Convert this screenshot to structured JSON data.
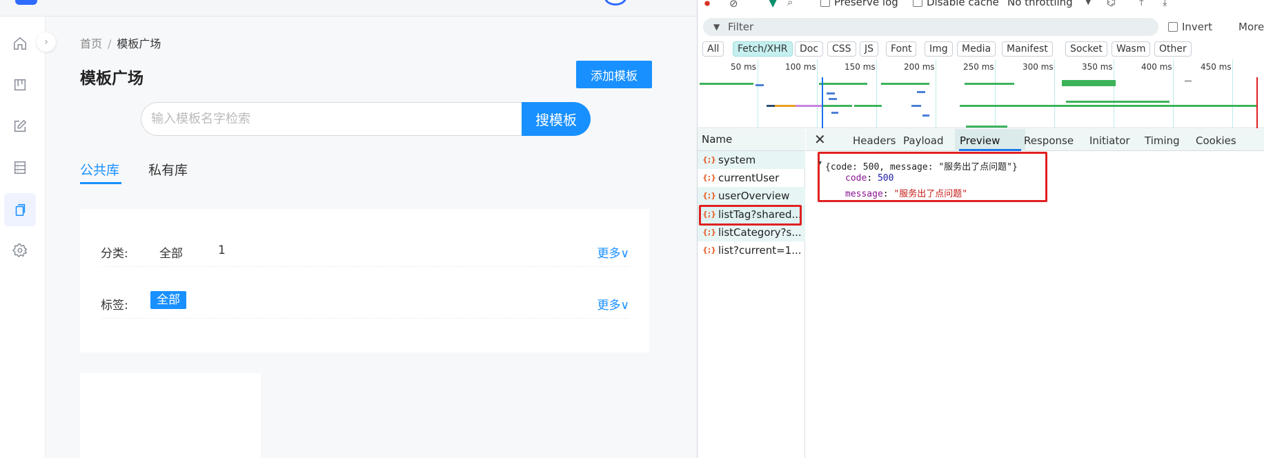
{
  "app": {
    "name": "...",
    "breadcrumb": {
      "home": "首页",
      "separator": "/",
      "current": "模板广场"
    },
    "title": "模板广场",
    "add_button": "添加模板",
    "search": {
      "placeholder": "输入模板名字检索",
      "button": "搜模板"
    },
    "tabs": [
      {
        "label": "公共库",
        "active": true
      },
      {
        "label": "私有库",
        "active": false
      }
    ],
    "filters": {
      "category": {
        "label": "分类:",
        "options": [
          "全部",
          "1"
        ],
        "more": "更多"
      },
      "tag": {
        "label": "标签:",
        "options": [
          "全部"
        ],
        "more": "更多"
      }
    },
    "sidebar_icons": [
      "home-icon",
      "board-icon",
      "edit-icon",
      "storage-icon",
      "copy-icon",
      "gear-icon"
    ],
    "accent_color": "#1890ff"
  },
  "devtools": {
    "toolbar": {
      "preserve_log": "Preserve log",
      "disable_cache": "Disable cache",
      "throttling": "No throttling"
    },
    "filter": {
      "placeholder": "Filter",
      "invert": "Invert",
      "more": "More"
    },
    "types": [
      "All",
      "Fetch/XHR",
      "Doc",
      "CSS",
      "JS",
      "Font",
      "Img",
      "Media",
      "Manifest",
      "Socket",
      "Wasm",
      "Other"
    ],
    "active_type": "Fetch/XHR",
    "timeline_ticks": [
      "50 ms",
      "100 ms",
      "150 ms",
      "200 ms",
      "250 ms",
      "300 ms",
      "350 ms",
      "400 ms",
      "450 ms"
    ],
    "name_header": "Name",
    "requests": [
      "system",
      "currentUser",
      "userOverview",
      "listTag?shared...",
      "listCategory?s...",
      "list?current=1..."
    ],
    "selected_request": "listTag?shared...",
    "detail_tabs": [
      "Headers",
      "Payload",
      "Preview",
      "Response",
      "Initiator",
      "Timing",
      "Cookies"
    ],
    "active_detail_tab": "Preview",
    "preview": {
      "summary": "{code: 500, message: \"服务出了点问题\"}",
      "code_key": "code",
      "code_value": "500",
      "message_key": "message",
      "message_value": "\"服务出了点问题\""
    },
    "highlight_color": "#e02020"
  }
}
